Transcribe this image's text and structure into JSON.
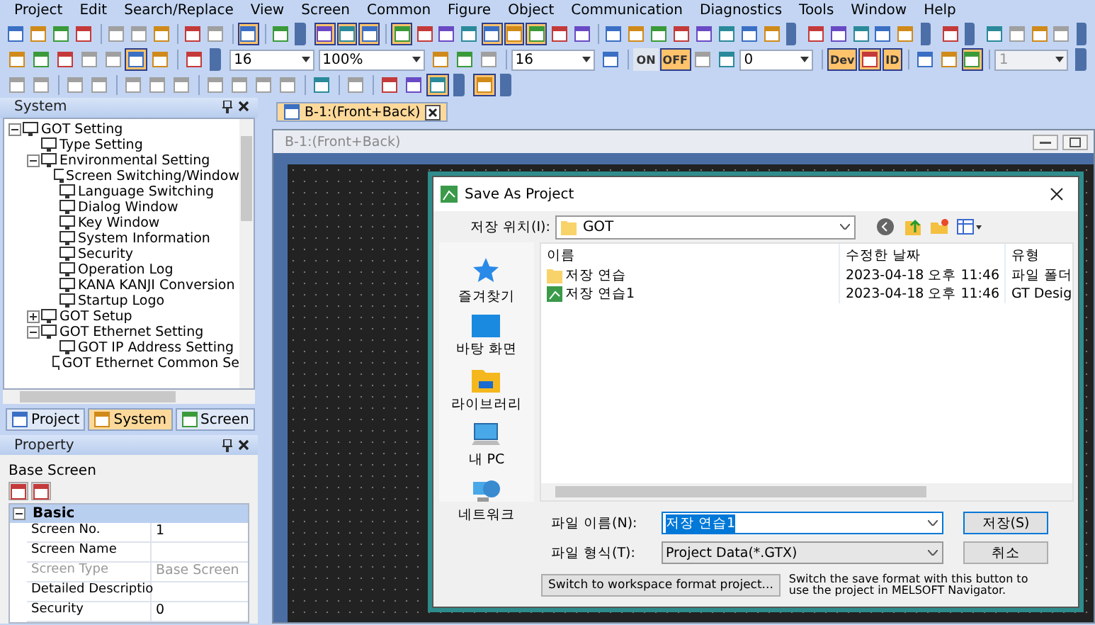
{
  "menu": [
    "Project",
    "Edit",
    "Search/Replace",
    "View",
    "Screen",
    "Common",
    "Figure",
    "Object",
    "Communication",
    "Diagnostics",
    "Tools",
    "Window",
    "Help"
  ],
  "toolbars": [
    [
      {
        "kind": "button",
        "pressed": false,
        "disabled": false
      },
      {
        "kind": "button",
        "pressed": false,
        "disabled": false
      },
      {
        "kind": "button",
        "pressed": false,
        "disabled": false
      },
      {
        "kind": "button",
        "pressed": false,
        "disabled": false
      },
      {
        "kind": "separator"
      },
      {
        "kind": "button",
        "pressed": false,
        "disabled": true
      },
      {
        "kind": "button",
        "pressed": false,
        "disabled": true
      },
      {
        "kind": "button",
        "pressed": false,
        "disabled": false
      },
      {
        "kind": "separator"
      },
      {
        "kind": "button",
        "pressed": false,
        "disabled": false
      },
      {
        "kind": "button",
        "pressed": false,
        "disabled": true
      },
      {
        "kind": "separator"
      },
      {
        "kind": "button",
        "pressed": true,
        "disabled": false
      },
      {
        "kind": "separator"
      },
      {
        "kind": "button",
        "pressed": false,
        "disabled": false
      },
      {
        "kind": "end"
      },
      {
        "kind": "button",
        "pressed": true,
        "disabled": false
      },
      {
        "kind": "button",
        "pressed": true,
        "disabled": false
      },
      {
        "kind": "button",
        "pressed": true,
        "disabled": false
      },
      {
        "kind": "separator"
      },
      {
        "kind": "button",
        "pressed": true,
        "disabled": false
      },
      {
        "kind": "button",
        "pressed": false,
        "disabled": false
      },
      {
        "kind": "button",
        "pressed": false,
        "disabled": false
      },
      {
        "kind": "button",
        "pressed": false,
        "disabled": false
      },
      {
        "kind": "button",
        "pressed": true,
        "disabled": false
      },
      {
        "kind": "button",
        "pressed": true,
        "disabled": false
      },
      {
        "kind": "button",
        "pressed": true,
        "disabled": false
      },
      {
        "kind": "button",
        "pressed": false,
        "disabled": false
      },
      {
        "kind": "button",
        "pressed": false,
        "disabled": false
      },
      {
        "kind": "separator"
      },
      {
        "kind": "button",
        "pressed": false,
        "disabled": false
      },
      {
        "kind": "button",
        "pressed": false,
        "disabled": false
      },
      {
        "kind": "button",
        "pressed": false,
        "disabled": false
      },
      {
        "kind": "button",
        "pressed": false,
        "disabled": false
      },
      {
        "kind": "button",
        "pressed": false,
        "disabled": false
      },
      {
        "kind": "button",
        "pressed": false,
        "disabled": false
      },
      {
        "kind": "button",
        "pressed": false,
        "disabled": false
      },
      {
        "kind": "button",
        "pressed": false,
        "disabled": false
      },
      {
        "kind": "end"
      },
      {
        "kind": "button",
        "pressed": false,
        "disabled": false
      },
      {
        "kind": "button",
        "pressed": false,
        "disabled": false
      },
      {
        "kind": "button",
        "pressed": false,
        "disabled": false
      },
      {
        "kind": "button",
        "pressed": false,
        "disabled": false
      },
      {
        "kind": "button",
        "pressed": false,
        "disabled": false
      },
      {
        "kind": "end"
      },
      {
        "kind": "button",
        "pressed": false,
        "disabled": false
      },
      {
        "kind": "end"
      },
      {
        "kind": "button",
        "pressed": false,
        "disabled": false
      },
      {
        "kind": "button",
        "pressed": false,
        "disabled": true
      },
      {
        "kind": "button",
        "pressed": false,
        "disabled": false
      },
      {
        "kind": "button",
        "pressed": false,
        "disabled": true
      },
      {
        "kind": "end"
      }
    ],
    [
      {
        "kind": "button",
        "pressed": false,
        "disabled": false
      },
      {
        "kind": "button",
        "pressed": false,
        "disabled": false
      },
      {
        "kind": "button",
        "pressed": false,
        "disabled": false
      },
      {
        "kind": "button",
        "pressed": false,
        "disabled": true
      },
      {
        "kind": "button",
        "pressed": false,
        "disabled": true
      },
      {
        "kind": "button",
        "pressed": true,
        "disabled": false
      },
      {
        "kind": "button",
        "pressed": false,
        "disabled": false
      },
      {
        "kind": "separator"
      },
      {
        "kind": "button",
        "pressed": false,
        "disabled": false
      },
      {
        "kind": "end"
      },
      {
        "kind": "combo",
        "value": "16",
        "disabled": false
      },
      {
        "kind": "combo",
        "value": "100%",
        "disabled": false
      },
      {
        "kind": "button",
        "pressed": false,
        "disabled": false
      },
      {
        "kind": "button",
        "pressed": false,
        "disabled": false
      },
      {
        "kind": "button",
        "pressed": false,
        "disabled": true
      },
      {
        "kind": "separator"
      },
      {
        "kind": "combo",
        "value": "16",
        "disabled": false
      },
      {
        "kind": "button",
        "pressed": false,
        "disabled": false
      },
      {
        "kind": "separator"
      },
      {
        "kind": "text-button",
        "label": "ON",
        "pressed": false
      },
      {
        "kind": "text-button",
        "label": "OFF",
        "pressed": true
      },
      {
        "kind": "button",
        "pressed": false,
        "disabled": true
      },
      {
        "kind": "button",
        "pressed": false,
        "disabled": false
      },
      {
        "kind": "combo",
        "value": "0",
        "disabled": false
      },
      {
        "kind": "separator"
      },
      {
        "kind": "text-button",
        "label": "Dev",
        "pressed": true
      },
      {
        "kind": "button",
        "pressed": true,
        "disabled": false
      },
      {
        "kind": "text-button",
        "label": "ID",
        "pressed": true
      },
      {
        "kind": "separator"
      },
      {
        "kind": "button",
        "pressed": false,
        "disabled": false
      },
      {
        "kind": "button",
        "pressed": false,
        "disabled": false
      },
      {
        "kind": "button",
        "pressed": true,
        "disabled": false
      },
      {
        "kind": "separator"
      },
      {
        "kind": "combo",
        "value": "1",
        "disabled": true
      },
      {
        "kind": "end"
      }
    ],
    [
      {
        "kind": "button",
        "pressed": false,
        "disabled": true
      },
      {
        "kind": "button",
        "pressed": false,
        "disabled": true
      },
      {
        "kind": "separator"
      },
      {
        "kind": "button",
        "pressed": false,
        "disabled": true
      },
      {
        "kind": "button",
        "pressed": false,
        "disabled": true
      },
      {
        "kind": "separator"
      },
      {
        "kind": "button",
        "pressed": false,
        "disabled": true
      },
      {
        "kind": "button",
        "pressed": false,
        "disabled": true
      },
      {
        "kind": "button",
        "pressed": false,
        "disabled": true
      },
      {
        "kind": "separator"
      },
      {
        "kind": "button",
        "pressed": false,
        "disabled": true
      },
      {
        "kind": "button",
        "pressed": false,
        "disabled": true
      },
      {
        "kind": "button",
        "pressed": false,
        "disabled": true
      },
      {
        "kind": "button",
        "pressed": false,
        "disabled": true
      },
      {
        "kind": "separator"
      },
      {
        "kind": "button",
        "pressed": false,
        "disabled": false
      },
      {
        "kind": "separator"
      },
      {
        "kind": "button",
        "pressed": false,
        "disabled": true
      },
      {
        "kind": "separator"
      },
      {
        "kind": "button",
        "pressed": false,
        "disabled": false
      },
      {
        "kind": "button",
        "pressed": false,
        "disabled": false
      },
      {
        "kind": "button",
        "pressed": true,
        "disabled": false
      },
      {
        "kind": "end"
      },
      {
        "kind": "button",
        "pressed": true,
        "disabled": false
      },
      {
        "kind": "end"
      }
    ]
  ],
  "system_panel": {
    "title": "System",
    "tree": [
      {
        "label": "GOT Setting",
        "expanded": true,
        "children": [
          {
            "label": "Type Setting"
          },
          {
            "label": "Environmental Setting",
            "expanded": true,
            "children": [
              {
                "label": "Screen Switching/Window"
              },
              {
                "label": "Language Switching"
              },
              {
                "label": "Dialog Window"
              },
              {
                "label": "Key Window"
              },
              {
                "label": "System Information"
              },
              {
                "label": "Security"
              },
              {
                "label": "Operation Log"
              },
              {
                "label": "KANA KANJI Conversion"
              },
              {
                "label": "Startup Logo"
              }
            ]
          },
          {
            "label": "GOT Setup",
            "expanded": false
          },
          {
            "label": "GOT Ethernet Setting",
            "expanded": true,
            "children": [
              {
                "label": "GOT IP Address Setting"
              },
              {
                "label": "GOT Ethernet Common Se"
              }
            ]
          }
        ]
      }
    ],
    "tabs": [
      {
        "label": "Project",
        "selected": false
      },
      {
        "label": "System",
        "selected": true
      },
      {
        "label": "Screen",
        "selected": false
      }
    ]
  },
  "property_panel": {
    "title": "Property",
    "subject": "Base Screen",
    "groups": [
      {
        "label": "Basic",
        "expanded": true,
        "rows": [
          {
            "name": "Screen No.",
            "value": "1",
            "disabled": false
          },
          {
            "name": "Screen Name",
            "value": "",
            "disabled": false
          },
          {
            "name": "Screen Type",
            "value": "Base Screen",
            "disabled": true
          },
          {
            "name": "Detailed Descriptio",
            "value": "",
            "disabled": false
          },
          {
            "name": "Security",
            "value": "0",
            "disabled": false
          }
        ]
      }
    ]
  },
  "editor": {
    "tabs": [
      {
        "label": "B-1:(Front+Back)",
        "selected": true
      }
    ],
    "window_title": "B-1:(Front+Back)"
  },
  "dialog": {
    "title": "Save As Project",
    "location_label": "저장 위치(I):",
    "location": "GOT",
    "places": [
      {
        "label": "즐겨찾기",
        "kind": "star"
      },
      {
        "label": "바탕 화면",
        "kind": "desktop"
      },
      {
        "label": "라이브러리",
        "kind": "library"
      },
      {
        "label": "내 PC",
        "kind": "pc"
      },
      {
        "label": "네트워크",
        "kind": "network"
      }
    ],
    "columns": [
      "이름",
      "수정한 날짜",
      "유형"
    ],
    "files": [
      {
        "kind": "folder",
        "name": "저장 연습",
        "date": "2023-04-18 오후 11:46",
        "type": "파일 폴더"
      },
      {
        "kind": "project",
        "name": "저장 연습1",
        "date": "2023-04-18 오후 11:46",
        "type": "GT Desig"
      }
    ],
    "filename_label": "파일 이름(N):",
    "filename": "저장 연습1",
    "filetype_label": "파일 형식(T):",
    "filetype": "Project Data(*.GTX)",
    "save_button": "저장(S)",
    "cancel_button": "취소",
    "workspace_button": "Switch to workspace format project...",
    "workspace_note": "Switch the save format with this button to use the project in MELSOFT Navigator."
  }
}
